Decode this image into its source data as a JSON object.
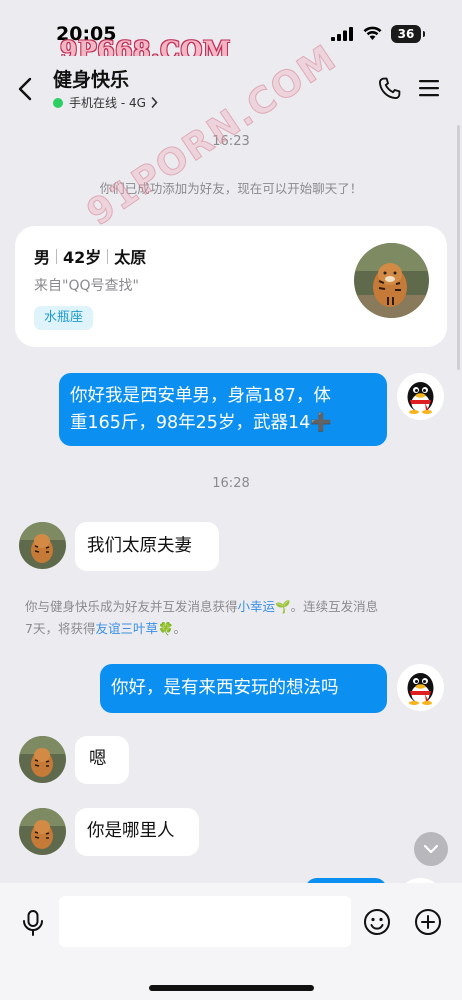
{
  "status_bar": {
    "time": "20:05",
    "battery": "36"
  },
  "watermark_top": "9P668.COM",
  "watermark_diag": "91PORN.COM",
  "header": {
    "title": "健身快乐",
    "status": "手机在线 - 4G"
  },
  "messages": {
    "time1": "16:23",
    "added_notice": "你们已成功添加为好友，现在可以开始聊天了！",
    "profile": {
      "gender": "男",
      "age": "42岁",
      "city": "太原",
      "source": "来自\"QQ号查找\"",
      "zodiac": "水瓶座"
    },
    "out1_line1": "你好我是西安单男，身高187，体",
    "out1_line2": "重165斤，98年25岁，武器14➕",
    "time2": "16:28",
    "in1": "我们太原夫妻",
    "system_line1_a": "你与健身快乐成为好友并互发消息获得",
    "system_line1_link": "小幸运",
    "system_line1_b": "🌱。连续互发消息",
    "system_line2_a": "7天，将获得",
    "system_line2_link": "友谊三叶草",
    "system_line2_b": "🍀。",
    "out2": "你好，是有来西安玩的想法吗",
    "in2": "嗯",
    "in3": "你是哪里人"
  },
  "input": {
    "placeholder": ""
  },
  "colors": {
    "background": "#ececf0",
    "outgoing_bubble": "#0b8ff0",
    "incoming_bubble": "#ffffff",
    "link": "#3a8fe3",
    "online_dot": "#2ccf61",
    "zodiac_tag_bg": "#dff3fb",
    "zodiac_tag_text": "#1e9bd4"
  },
  "icons": [
    "signal-icon",
    "wifi-icon",
    "battery-icon",
    "back-icon",
    "chevron-right-icon",
    "phone-icon",
    "menu-icon",
    "tiger-avatar",
    "qq-penguin-avatar",
    "chevron-down-icon",
    "mic-icon",
    "emoji-icon",
    "plus-icon"
  ]
}
